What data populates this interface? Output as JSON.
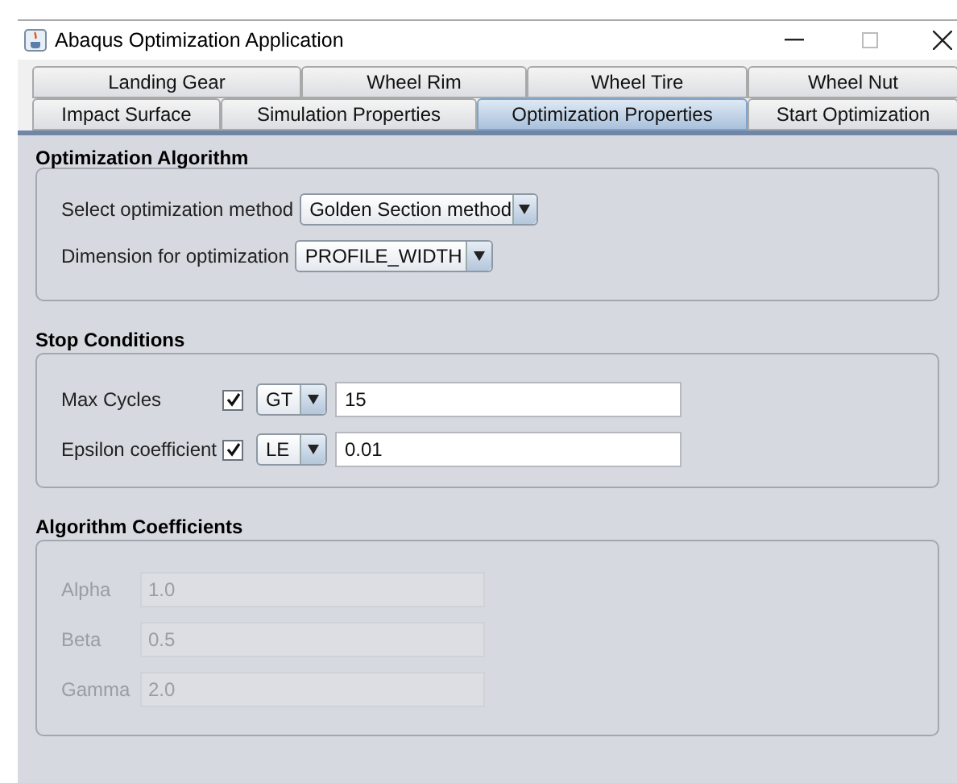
{
  "window": {
    "title": "Abaqus Optimization Application"
  },
  "tabs": [
    [
      {
        "label": "Landing Gear",
        "selected": false
      },
      {
        "label": "Wheel Rim",
        "selected": false
      },
      {
        "label": "Wheel Tire",
        "selected": false
      },
      {
        "label": "Wheel Nut",
        "selected": false
      }
    ],
    [
      {
        "label": "Impact Surface",
        "selected": false
      },
      {
        "label": "Simulation Properties",
        "selected": false
      },
      {
        "label": "Optimization Properties",
        "selected": true
      },
      {
        "label": "Start Optimization",
        "selected": false
      }
    ]
  ],
  "optimization_algorithm": {
    "title": "Optimization Algorithm",
    "rows": [
      {
        "label": "Select optimization method",
        "value": "Golden Section method"
      },
      {
        "label": "Dimension for optimization",
        "value": "PROFILE_WIDTH"
      }
    ]
  },
  "stop_conditions": {
    "title": "Stop Conditions",
    "rows": [
      {
        "label": "Max Cycles",
        "checked": true,
        "operator": "GT",
        "value": "15"
      },
      {
        "label": "Epsilon coefficient",
        "checked": true,
        "operator": "LE",
        "value": "0.01"
      }
    ]
  },
  "algorithm_coefficients": {
    "title": "Algorithm Coefficients",
    "rows": [
      {
        "label": "Alpha",
        "value": "1.0",
        "disabled": true
      },
      {
        "label": "Beta",
        "value": "0.5",
        "disabled": true
      },
      {
        "label": "Gamma",
        "value": "2.0",
        "disabled": true
      }
    ]
  }
}
